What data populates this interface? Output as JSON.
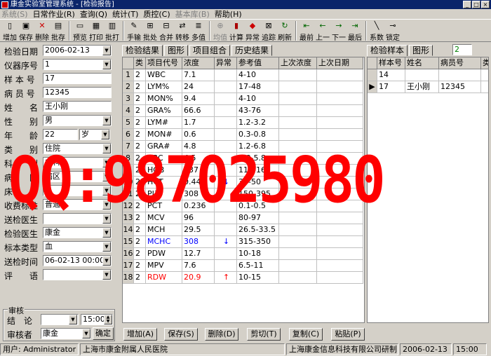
{
  "window": {
    "title": "康金实验室管理系统 - [检验报告]"
  },
  "menu": [
    "系统(S)",
    "日常作业(R)",
    "查询(Q)",
    "统计(T)",
    "质控(C)",
    "基本库(B)",
    "帮助(H)"
  ],
  "menu_disabled": [
    0,
    5
  ],
  "toolbar": [
    {
      "label": "增加",
      "icon": "new-doc-icon"
    },
    {
      "label": "保存",
      "icon": "save-icon"
    },
    {
      "label": "删除",
      "icon": "delete-icon"
    },
    {
      "label": "批存",
      "icon": "batch-save-icon"
    },
    {
      "label": "预览",
      "icon": "preview-icon"
    },
    {
      "label": "打印",
      "icon": "print-icon"
    },
    {
      "label": "批打",
      "icon": "batch-print-icon"
    },
    {
      "label": "手输",
      "icon": "manual-input-icon"
    },
    {
      "label": "批处",
      "icon": "batch-process-icon"
    },
    {
      "label": "合并",
      "icon": "merge-icon"
    },
    {
      "label": "转移",
      "icon": "transfer-icon"
    },
    {
      "label": "多值",
      "icon": "multi-value-icon"
    },
    {
      "label": "均值",
      "icon": "mean-icon"
    },
    {
      "label": "计算",
      "icon": "calculate-icon"
    },
    {
      "label": "异常",
      "icon": "abnormal-icon"
    },
    {
      "label": "追踪",
      "icon": "trace-icon"
    },
    {
      "label": "刷新",
      "icon": "refresh-icon"
    },
    {
      "label": "最前",
      "icon": "first-icon"
    },
    {
      "label": "上一",
      "icon": "prev-icon"
    },
    {
      "label": "下一",
      "icon": "next-icon"
    },
    {
      "label": "最后",
      "icon": "last-icon"
    },
    {
      "label": "系数",
      "icon": "coefficient-icon"
    },
    {
      "label": "锁定",
      "icon": "lock-icon"
    }
  ],
  "form": {
    "date_label": "检验日期",
    "date_value": "2006-02-13",
    "instrument_label": "仪器序号",
    "instrument_value": "1",
    "sample_label": "样 本 号",
    "sample_value": "17",
    "patient_label": "病 员 号",
    "patient_value": "12345",
    "name_label": "姓　　名",
    "name_value": "王小刚",
    "sex_label": "性　　别",
    "sex_value": "男",
    "age_label": "年　　龄",
    "age_value": "22",
    "age_unit": "岁",
    "type_label": "类　　别",
    "type_value": "住院",
    "dept_label": "科　　别",
    "dept_value": "内科",
    "ward_label": "病　　区",
    "ward_value": "病区",
    "bed_label": "床　　号",
    "bed_value": "",
    "fee_label": "收费标准",
    "fee_value": "普通",
    "sender_label": "送检医生",
    "sender_value": "",
    "checker_label": "检验医生",
    "checker_value": "康金",
    "specimen_label": "标本类型",
    "specimen_value": "血",
    "sendtime_label": "送检时间",
    "sendtime_value": "06-02-13 00:00",
    "comment_label": "评　　语",
    "comment_value": ""
  },
  "audit": {
    "group_title": "审核",
    "conclusion_label": "结　论",
    "conclusion_value": "",
    "time_value": "15:00",
    "auditor_label": "审核者",
    "auditor_value": "康金",
    "confirm_label": "确定"
  },
  "center_tabs": [
    "检验结果",
    "图形",
    "项目组合",
    "历史结果"
  ],
  "right_tabs": [
    "检验样本",
    "图形"
  ],
  "right_count": "2",
  "results": {
    "columns": [
      "",
      "类",
      "项目代号",
      "浓度",
      "异常",
      "参考值",
      "上次浓度",
      "上次日期"
    ],
    "rows": [
      {
        "n": "1",
        "cls": "2",
        "code": "WBC",
        "val": "7.1",
        "flag": "",
        "ref": "4-10",
        "color": ""
      },
      {
        "n": "2",
        "cls": "2",
        "code": "LYM%",
        "val": "24",
        "flag": "",
        "ref": "17-48",
        "color": ""
      },
      {
        "n": "3",
        "cls": "2",
        "code": "MON%",
        "val": "9.4",
        "flag": "",
        "ref": "4-10",
        "color": ""
      },
      {
        "n": "4",
        "cls": "2",
        "code": "GRA%",
        "val": "66.6",
        "flag": "",
        "ref": "43-76",
        "color": ""
      },
      {
        "n": "5",
        "cls": "2",
        "code": "LYM#",
        "val": "1.7",
        "flag": "",
        "ref": "1.2-3.2",
        "color": ""
      },
      {
        "n": "6",
        "cls": "2",
        "code": "MON#",
        "val": "0.6",
        "flag": "",
        "ref": "0.3-0.8",
        "color": ""
      },
      {
        "n": "7",
        "cls": "2",
        "code": "GRA#",
        "val": "4.8",
        "flag": "",
        "ref": "1.2-6.8",
        "color": ""
      },
      {
        "n": "8",
        "cls": "2",
        "code": "RBC",
        "val": "4.5",
        "flag": "",
        "ref": "3.8-5.8",
        "color": ""
      },
      {
        "n": "9",
        "cls": "2",
        "code": "HGB",
        "val": "137",
        "flag": "",
        "ref": "110-165",
        "color": ""
      },
      {
        "n": "10",
        "cls": "2",
        "code": "HCT",
        "val": "0.445",
        "flag": "↓",
        "ref": "35-50",
        "color": ""
      },
      {
        "n": "11",
        "cls": "2",
        "code": "PLT",
        "val": "308",
        "flag": "",
        "ref": "150-395",
        "color": ""
      },
      {
        "n": "12",
        "cls": "2",
        "code": "PCT",
        "val": "0.236",
        "flag": "",
        "ref": "0.1-0.5",
        "color": ""
      },
      {
        "n": "13",
        "cls": "2",
        "code": "MCV",
        "val": "96",
        "flag": "",
        "ref": "80-97",
        "color": ""
      },
      {
        "n": "14",
        "cls": "2",
        "code": "MCH",
        "val": "29.5",
        "flag": "",
        "ref": "26.5-33.5",
        "color": ""
      },
      {
        "n": "15",
        "cls": "2",
        "code": "MCHC",
        "val": "308",
        "flag": "↓",
        "ref": "315-350",
        "color": "#0000ff"
      },
      {
        "n": "16",
        "cls": "2",
        "code": "PDW",
        "val": "12.7",
        "flag": "",
        "ref": "10-18",
        "color": ""
      },
      {
        "n": "17",
        "cls": "2",
        "code": "MPV",
        "val": "7.6",
        "flag": "",
        "ref": "6.5-11",
        "color": ""
      },
      {
        "n": "18",
        "cls": "2",
        "code": "RDW",
        "val": "20.9",
        "flag": "↑",
        "ref": "10-15",
        "color": "#ff0000"
      }
    ]
  },
  "samples": {
    "columns": [
      "",
      "样本号",
      "姓名",
      "病员号",
      "类"
    ],
    "rows": [
      {
        "mark": "",
        "no": "14",
        "name": "",
        "pid": ""
      },
      {
        "mark": "▶",
        "no": "17",
        "name": "王小刚",
        "pid": "12345"
      }
    ]
  },
  "bottom_buttons": [
    "增加(A)",
    "保存(S)",
    "删除(D)",
    "剪切(T)",
    "复制(C)",
    "粘贴(P)"
  ],
  "status": {
    "user": "用户: Administrator",
    "hospital": "上海市康金附属人民医院",
    "company": "上海康金信息科技有限公司研制",
    "date": "2006-02-13",
    "time": "15:00"
  },
  "watermark": "QQ:987025980",
  "colors": {
    "title_bg": "#0a246a",
    "watermark": "#ff0000",
    "alert_low": "#0000ff",
    "alert_high": "#ff0000"
  }
}
